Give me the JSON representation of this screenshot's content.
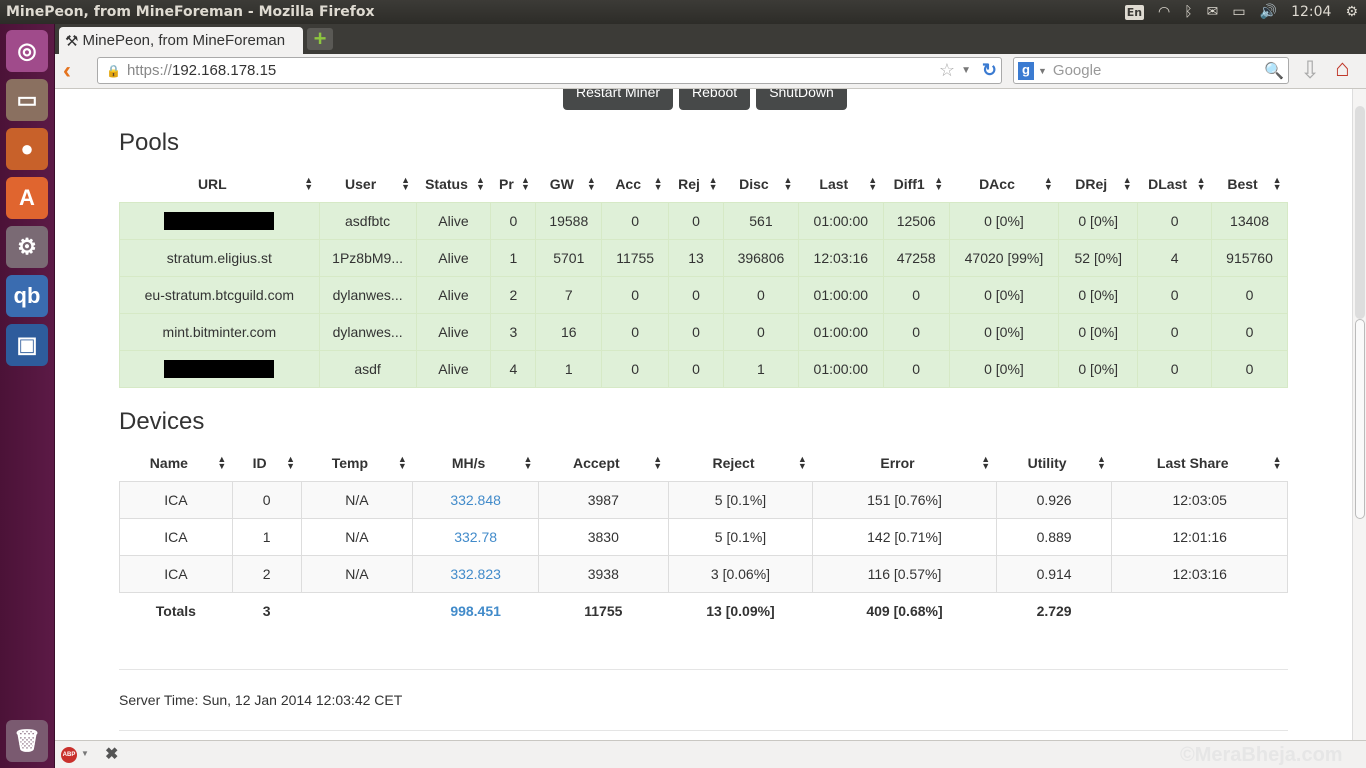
{
  "os": {
    "window_title": "MinePeon, from MineForeman - Mozilla Firefox",
    "tray": {
      "keyboard": "En",
      "clock": "12:04"
    },
    "launcher": [
      {
        "name": "ubuntu-dash",
        "glyph": "◎",
        "color": "#a04b8b"
      },
      {
        "name": "files",
        "glyph": "▭",
        "color": "#8a7060"
      },
      {
        "name": "firefox",
        "glyph": "●",
        "color": "#c8612a"
      },
      {
        "name": "software-center",
        "glyph": "A",
        "color": "#e0652f"
      },
      {
        "name": "system-settings",
        "glyph": "⚙",
        "color": "#7a6a74"
      },
      {
        "name": "qbittorrent",
        "glyph": "qb",
        "color": "#3a6cb0"
      },
      {
        "name": "virtualbox",
        "glyph": "▣",
        "color": "#2e5c9c"
      }
    ],
    "trash": "🗑"
  },
  "browser": {
    "tab_title": "MinePeon, from MineForeman",
    "tab_icon": "⚒",
    "url_protocol": "https://",
    "url_host": "192.168.178.15",
    "search_placeholder": "Google"
  },
  "page": {
    "buttons": [
      "Restart Miner",
      "Reboot",
      "ShutDown"
    ],
    "pools": {
      "title": "Pools",
      "headers": [
        "URL",
        "User",
        "Status",
        "Pr",
        "GW",
        "Acc",
        "Rej",
        "Disc",
        "Last",
        "Diff1",
        "DAcc",
        "DRej",
        "DLast",
        "Best"
      ],
      "rows": [
        [
          "[redacted]",
          "asdfbtc",
          "Alive",
          "0",
          "19588",
          "0",
          "0",
          "561",
          "01:00:00",
          "12506",
          "0 [0%]",
          "0 [0%]",
          "0",
          "13408"
        ],
        [
          "stratum.eligius.st",
          "1Pz8bM9...",
          "Alive",
          "1",
          "5701",
          "11755",
          "13",
          "396806",
          "12:03:16",
          "47258",
          "47020 [99%]",
          "52 [0%]",
          "4",
          "915760"
        ],
        [
          "eu-stratum.btcguild.com",
          "dylanwes...",
          "Alive",
          "2",
          "7",
          "0",
          "0",
          "0",
          "01:00:00",
          "0",
          "0 [0%]",
          "0 [0%]",
          "0",
          "0"
        ],
        [
          "mint.bitminter.com",
          "dylanwes...",
          "Alive",
          "3",
          "16",
          "0",
          "0",
          "0",
          "01:00:00",
          "0",
          "0 [0%]",
          "0 [0%]",
          "0",
          "0"
        ],
        [
          "[redacted]",
          "asdf",
          "Alive",
          "4",
          "1",
          "0",
          "0",
          "1",
          "01:00:00",
          "0",
          "0 [0%]",
          "0 [0%]",
          "0",
          "0"
        ]
      ]
    },
    "devices": {
      "title": "Devices",
      "headers": [
        "Name",
        "ID",
        "Temp",
        "MH/s",
        "Accept",
        "Reject",
        "Error",
        "Utility",
        "Last Share"
      ],
      "rows": [
        [
          "ICA",
          "0",
          "N/A",
          "332.848",
          "3987",
          "5 [0.1%]",
          "151 [0.76%]",
          "0.926",
          "12:03:05"
        ],
        [
          "ICA",
          "1",
          "N/A",
          "332.78",
          "3830",
          "5 [0.1%]",
          "142 [0.71%]",
          "0.889",
          "12:01:16"
        ],
        [
          "ICA",
          "2",
          "N/A",
          "332.823",
          "3938",
          "3 [0.06%]",
          "116 [0.57%]",
          "0.914",
          "12:03:16"
        ]
      ],
      "totals": [
        "Totals",
        "3",
        "",
        "998.451",
        "11755",
        "13 [0.09%]",
        "409 [0.68%]",
        "2.729",
        ""
      ]
    },
    "server_time": "Server Time: Sun, 12 Jan 2014 12:03:42 CET"
  },
  "watermark": "©MeraBheja.com",
  "colors": {
    "pool_row_bg": "#dff0d8",
    "link": "#428bca",
    "button_bg": "#474949"
  }
}
